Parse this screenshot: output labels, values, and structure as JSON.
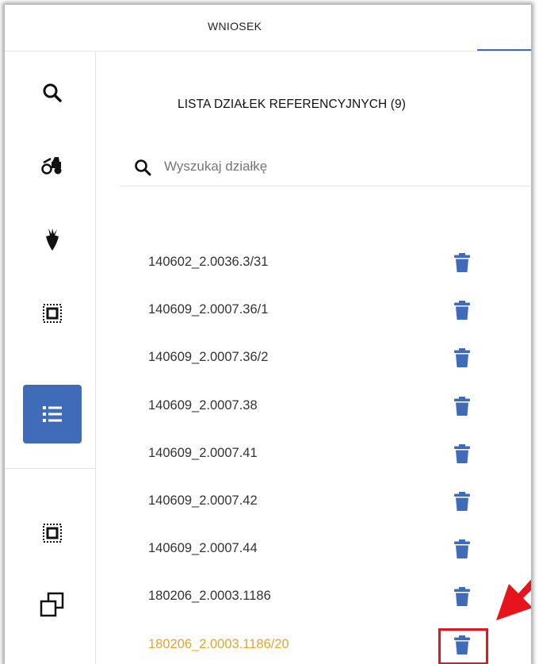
{
  "header": {
    "title": "WNIOSEK"
  },
  "sidebar": {
    "buttons": [
      {
        "name": "search-icon"
      },
      {
        "name": "tractor-icon"
      },
      {
        "name": "beet-icon"
      },
      {
        "name": "select-area-icon"
      },
      {
        "name": "list-icon",
        "active": true
      },
      {
        "name": "select-area-icon"
      },
      {
        "name": "copy-icon"
      }
    ],
    "active_color": "#3f6bb8"
  },
  "panel": {
    "title": "LISTA DZIAŁEK REFERENCYJNYCH (9)",
    "search": {
      "placeholder": "Wyszukaj działkę",
      "value": ""
    },
    "parcels": [
      "140602_2.0036.3/31",
      "140609_2.0007.36/1",
      "140609_2.0007.36/2",
      "140609_2.0007.38",
      "140609_2.0007.41",
      "140609_2.0007.42",
      "140609_2.0007.44",
      "180206_2.0003.1186",
      "180206_2.0003.1186/20"
    ],
    "highlighted_index": 8,
    "highlight_color": "#e0a430",
    "delete_icon": "trash-icon",
    "delete_color": "#3f6bb8"
  },
  "annotation": {
    "color": "#e8141b"
  }
}
